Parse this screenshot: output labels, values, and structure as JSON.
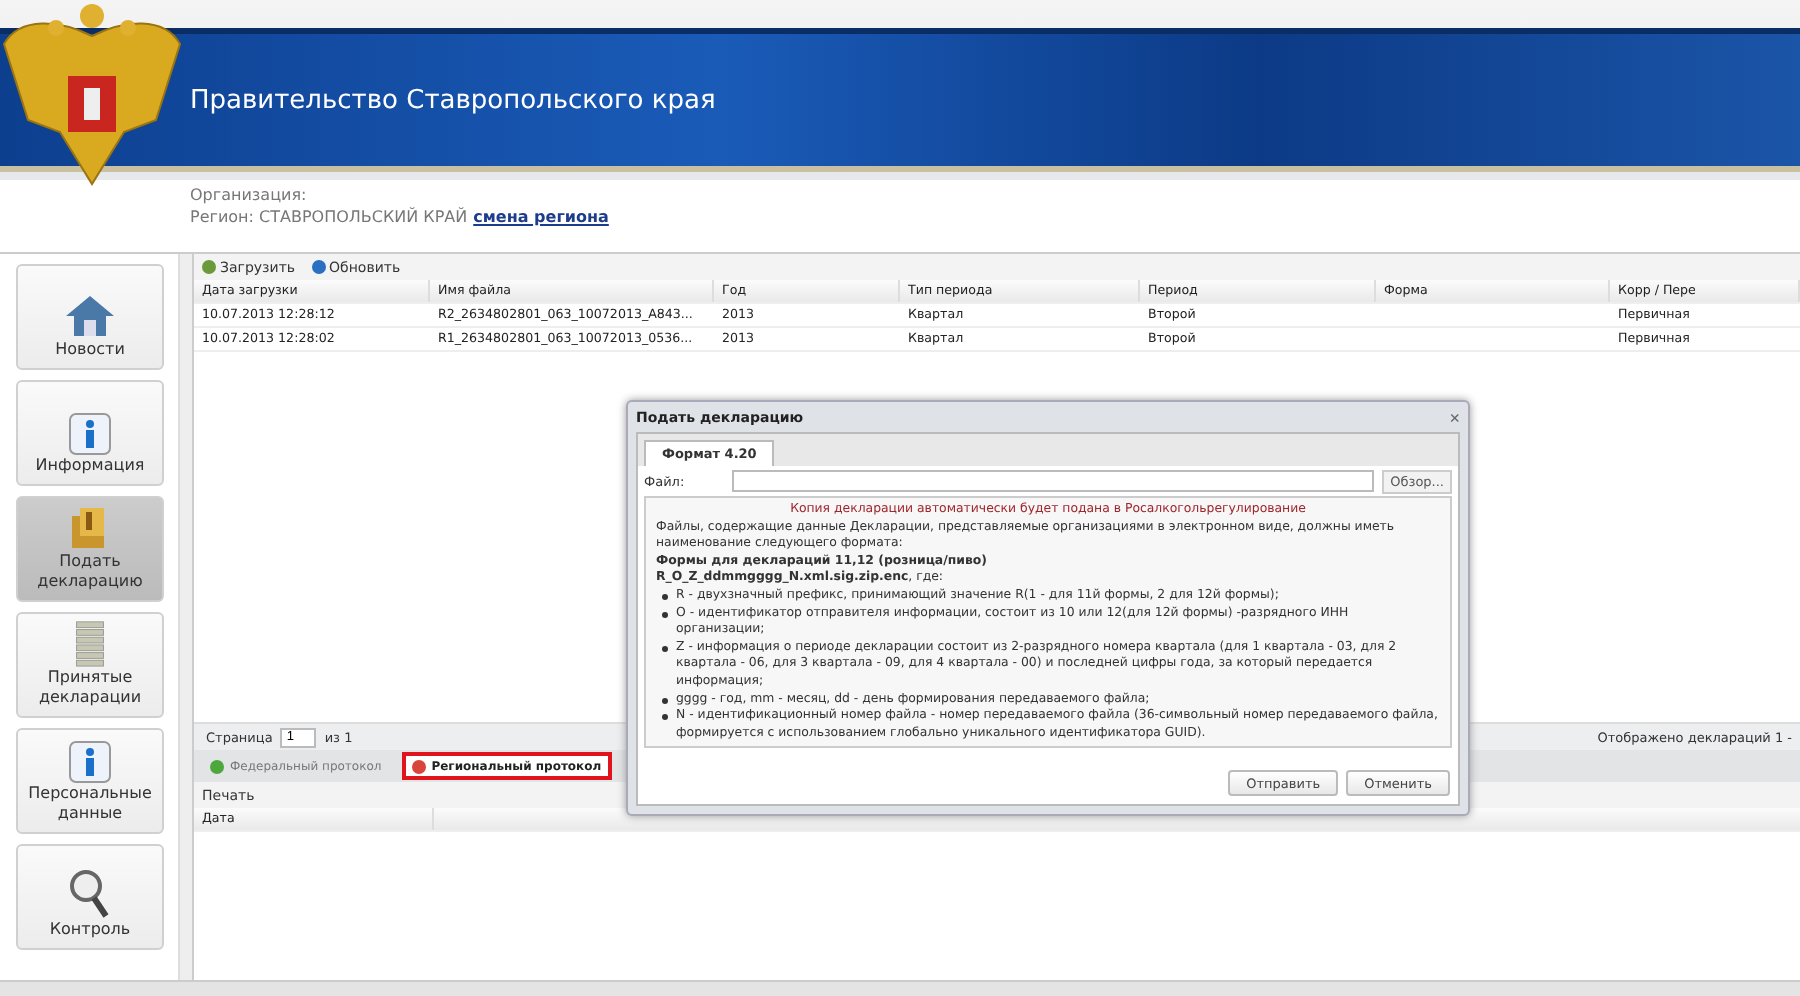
{
  "header": {
    "title": "Правительство Ставропольского края",
    "organization_label": "Организация:",
    "region_label": "Регион: СТАВРОПОЛЬСКИЙ КРАЙ",
    "change_region_link": "смена региона"
  },
  "sidebar": {
    "items": [
      {
        "label": "Новости",
        "kind": "house",
        "selected": false
      },
      {
        "label": "Информация",
        "kind": "info",
        "selected": false
      },
      {
        "label": "Подать декларацию",
        "kind": "submit",
        "selected": true
      },
      {
        "label": "Принятые декларации",
        "kind": "stack",
        "selected": false
      },
      {
        "label": "Персональные данные",
        "kind": "info",
        "selected": false
      },
      {
        "label": "Контроль",
        "kind": "magnifier",
        "selected": false
      }
    ]
  },
  "toolbar": [
    "Загрузить",
    "Обновить"
  ],
  "table": {
    "columns": [
      "Дата загрузки",
      "Имя файла",
      "Год",
      "Тип периода",
      "Период",
      "Форма",
      "Корр / Пере"
    ],
    "rows": [
      [
        "10.07.2013 12:28:12",
        "R2_2634802801_063_10072013_A843...",
        "2013",
        "Квартал",
        "Второй",
        "",
        "Первичная"
      ],
      [
        "10.07.2013 12:28:02",
        "R1_2634802801_063_10072013_0536...",
        "2013",
        "Квартал",
        "Второй",
        "",
        "Первичная"
      ]
    ]
  },
  "paging": {
    "page_label": "Страница",
    "page": "1",
    "of": "из 1",
    "summary": "Отображено деклараций 1 -"
  },
  "protocol_tabs": [
    {
      "label": "Федеральный протокол",
      "kind": "ok",
      "selected": false
    },
    {
      "label": "Региональный протокол",
      "kind": "error",
      "selected": true
    }
  ],
  "protocol_toolbar": [
    "Печать"
  ],
  "protocol_columns": [
    "Дата"
  ],
  "dialog": {
    "title": "Подать декларацию",
    "close": "×",
    "tabs": [
      {
        "label": "Формат 4.20",
        "selected": true
      }
    ],
    "file_label": "Файл:",
    "browse": "Обзор...",
    "notice": "Копия декларации автоматически будет подана в Росалкогольрегулирование",
    "intro": "Файлы, содержащие данные Декларации, представляемые организациями в электронном виде, должны иметь наименование следующего формата:",
    "heading": "Формы для деклараций 11,12 (розница/пиво)",
    "pattern": "**R_O_Z_ddmmgggg_N.xml.sig.zip.enc**, где:",
    "bullets": [
      "R - двухзначный префикс, принимающий значение R(1 - для 11й формы, 2 для 12й формы);",
      "O - идентификатор отправителя информации, состоит из 10 или 12(для 12й формы) -разрядного ИНН организации;",
      "Z - информация о периоде декларации состоит из 2-разрядного номера квартала (для 1 квартала - 03, для 2 квартала - 06, для 3 квартала - 09, для 4 квартала - 00) и последней цифры года, за который передается информация;",
      "gggg - год, mm - месяц, dd - день формирования передаваемого файла;",
      "N - идентификационный номер файла - номер передаваемого файла (36-символьный номер передаваемого файла, формируется с использованием глобально уникального идентификатора GUID)."
    ],
    "buttons": [
      "Отправить",
      "Отменить"
    ]
  }
}
